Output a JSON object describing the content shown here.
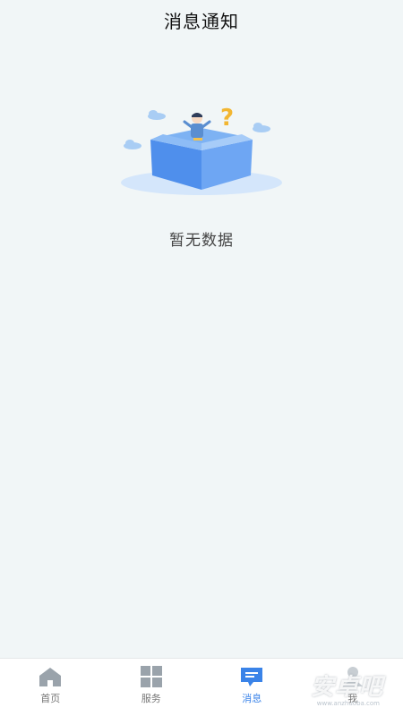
{
  "header": {
    "title": "消息通知"
  },
  "empty_state": {
    "text": "暂无数据",
    "illustration": "empty-box-illustration"
  },
  "tabbar": {
    "items": [
      {
        "label": "首页",
        "icon": "home-icon",
        "active": false
      },
      {
        "label": "服务",
        "icon": "grid-icon",
        "active": false
      },
      {
        "label": "消息",
        "icon": "message-icon",
        "active": true
      },
      {
        "label": "我",
        "icon": "user-icon",
        "active": false
      }
    ]
  },
  "watermark": {
    "text": "安卓吧",
    "sub": "www.anzhuoba.com"
  },
  "colors": {
    "accent": "#3a83e8",
    "background": "#f1f6f7",
    "inactive": "#999999"
  }
}
